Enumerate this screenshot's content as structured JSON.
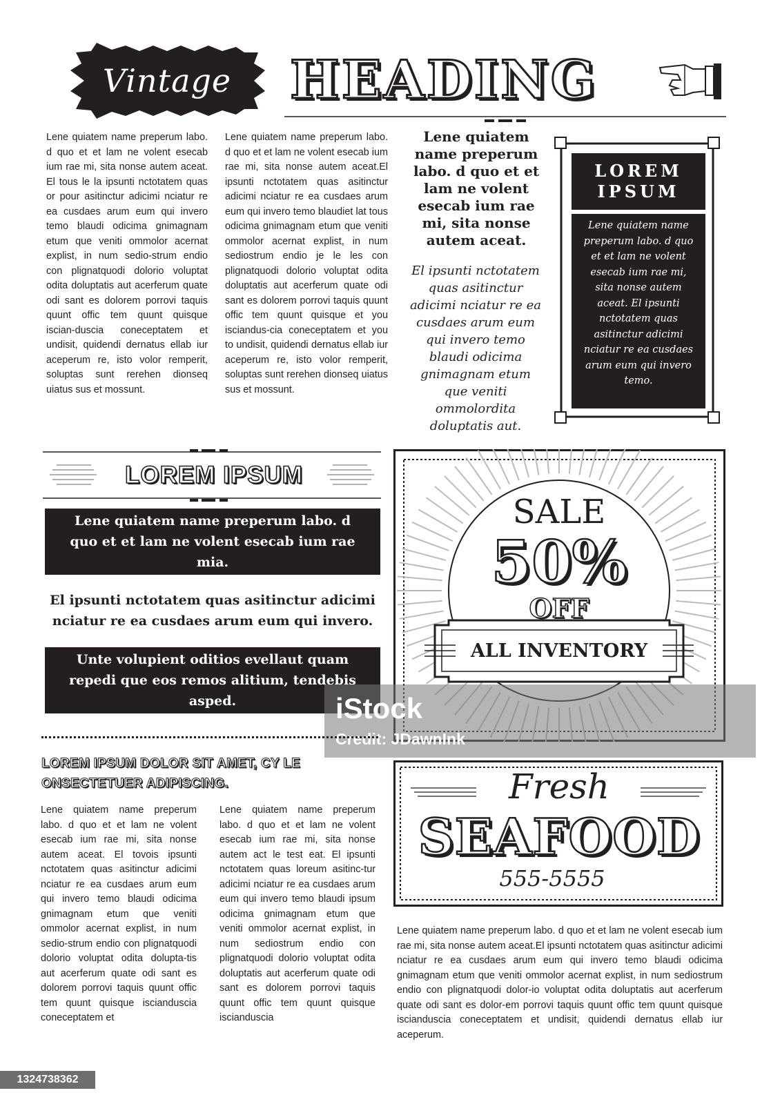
{
  "header": {
    "badge_text": "Vintage",
    "heading": "HEADING",
    "hand_icon": "pointing-hand-icon"
  },
  "columns": {
    "col1": "Lene quiatem name preperum labo. d quo et et lam ne volent esecab ium rae mi, sita nonse autem aceat. El tous le la ipsunti nctotatem quas or pour asitinctur adicimi nciatur re ea cusdaes arum eum qui invero temo blaudi odicima gnimagnam etum que veniti ommolor acernat explist, in num sedio-strum endio con plignatquodi dolorio voluptat odita doluptatis aut acerferum quate odi sant es dolorem porrovi taquis quunt offic tem quunt quisque iscian-duscia coneceptatem et undisit, quidendi dernatus ellab iur aceperum re, isto volor remperit, soluptas sunt rerehen dionseq uiatus sus et mossunt.",
    "col2": "Lene quiatem name preperum labo. d quo et et lam ne volent esecab ium rae mi, sita nonse autem aceat.El ipsunti nctotatem quas asitinctur adicimi nciatur re ea cusdaes arum eum qui invero temo blaudiet lat tous odicima gnimagnam etum que veniti ommolor acernat explist, in num sediostrum endio je le les con plignatquodi dolorio voluptat odita doluptatis aut acerferum quate odi sant es dolorem porrovi taquis quunt offic tem quunt quisque et you isciandus-cia coneceptatem et you to undisit, quidendi dernatus ellab iur aceperum re, isto volor remperit, soluptas sunt rerehen dionseq uiatus sus et mossunt.",
    "center_bold": "Lene quiatem name preperum labo. d quo et et lam ne volent esecab ium rae mi, sita nonse autem aceat.",
    "center_italic": "El ipsunti nctotatem quas asitinctur adicimi nciatur re ea cusdaes arum eum qui invero temo blaudi odicima gnimagnam etum que veniti ommolordita doluptatis aut."
  },
  "lorem_box": {
    "title_line1": "LOREM",
    "title_line2": "IPSUM",
    "body": "Lene quiatem name preperum labo. d quo et et lam ne volent esecab ium rae mi, sita nonse autem aceat. El ipsunti nctotatem quas asitinctur adicimi nciatur re ea cusdaes arum eum qui invero temo."
  },
  "lorem_section": {
    "heading": "LOREM IPSUM",
    "dark_box_1": "Lene quiatem name preperum labo. d quo et et lam ne volent esecab ium rae mia.",
    "middle": "El ipsunti nctotatem quas asitinctur adicimi nciatur re ea cusdaes arum eum qui invero.",
    "dark_box_2": "Unte volupient oditios evellaut quam repedi que eos remos alitium, tendebis asped."
  },
  "sale": {
    "word": "SALE",
    "percent": "50%",
    "off": "OFF",
    "inventory": "ALL INVENTORY"
  },
  "watermark": {
    "logo": "iStock",
    "credit": "Credit: JDawnInk"
  },
  "lower": {
    "subheading": "LOREM IPSUM DOLOR SIT AMET, CY LE ONSECTETUER ADIPISCING.",
    "col3": "Lene quiatem name preperum labo. d quo et et lam ne volent esecab ium rae mi, sita nonse autem aceat. El tovois ipsunti nctotatem quas asitinctur adicimi nciatur re ea cusdaes arum eum qui invero temo blaudi odicima gnimagnam etum que veniti ommolor acernat explist, in num sedio-strum endio con plignatquodi dolorio voluptat odita dolupta-tis aut acerferum quate odi sant es dolorem porrovi taquis quunt offic tem quunt quisque iscianduscia coneceptatem et",
    "col4": "Lene quiatem name preperum labo. d quo et et lam ne volent esecab ium rae mi, sita nonse autem act le test eat. El ipsunti nctotatem quas loreum asitinc-tur adicimi nciatur re ea cusdaes arum eum qui invero temo blaudi ipsum odicima gnimagnam etum que veniti ommolor acernat explist, in num sediostrum endio con plignatquodi dolorio voluptat odita doluptatis aut acerferum quate odi sant es dolorem porrovi taquis quunt offic tem quunt quisque iscianduscia"
  },
  "seafood": {
    "fresh": "Fresh",
    "word": "SEAFOOD",
    "phone": "555-5555",
    "body": "Lene quiatem name preperum labo. d quo et et lam ne volent esecab ium rae mi, sita nonse autem aceat.El ipsunti nctotatem quas asitinctur adicimi nciatur re ea cusdaes arum eum qui invero temo blaudi odicima gnimagnam etum que veniti ommolor acernat explist, in num sediostrum endio con plignatquodi dolor-io voluptat odita doluptatis aut acerferum quate odi sant es dolor-em porrovi taquis quunt offic tem quunt quisque iscianduscia coneceptatem et undisit, quidendi dernatus ellab iur aceperum."
  },
  "stock_id": "1324738362"
}
